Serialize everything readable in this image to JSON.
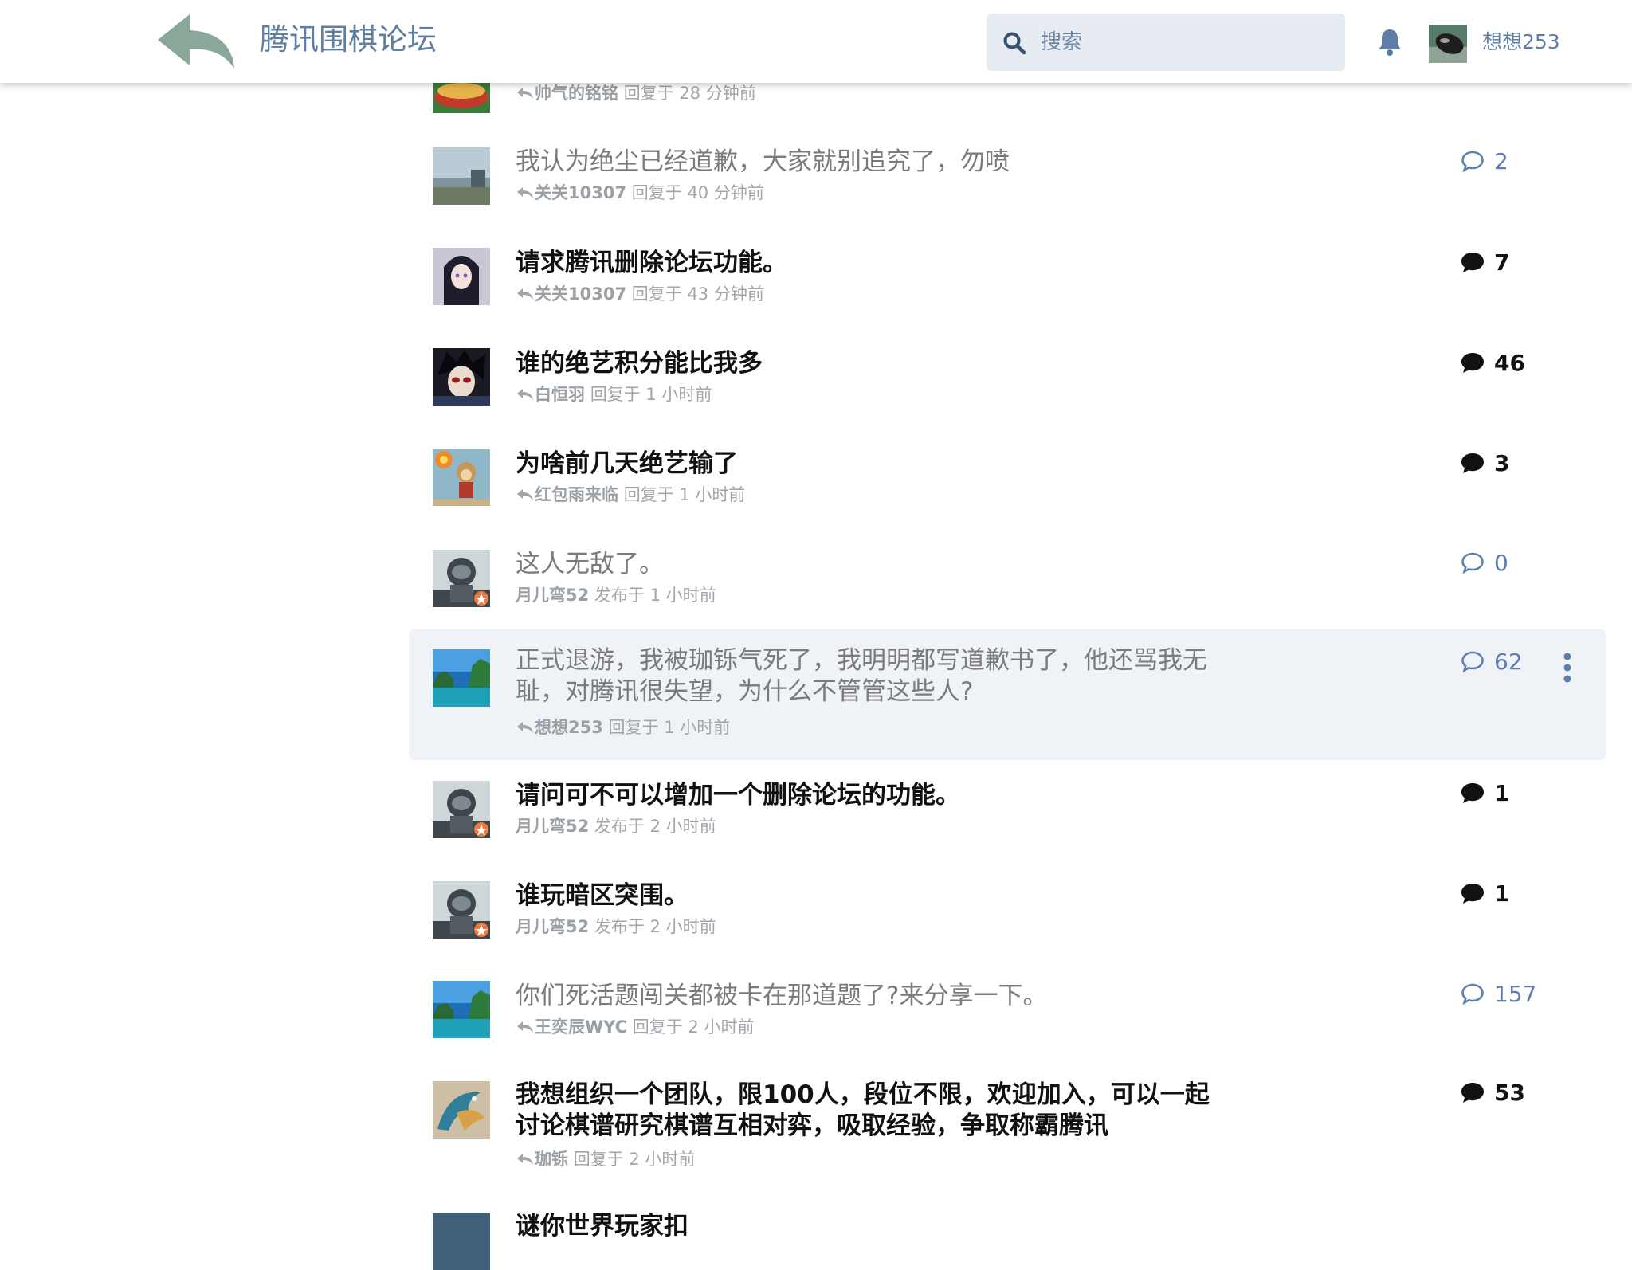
{
  "header": {
    "forum_title": "腾讯围棋论坛",
    "search_placeholder": "搜索",
    "username": "想想253",
    "back_icon": "reply-arrow-icon",
    "notification_icon": "bell-icon"
  },
  "colors": {
    "accent": "#5d7fa6",
    "search_bg": "#e7ecf3",
    "active_row_bg": "#eff3f7",
    "unread_title": "#111111",
    "read_title": "#7b7b7b",
    "meta_text": "#a2a6ab",
    "read_count": "#5f7eb0"
  },
  "topics": [
    {
      "title": "",
      "user": "帅气的铭铭",
      "action": "回复于",
      "time": "28 分钟前",
      "replies": "",
      "read": true,
      "replied": true,
      "avatar": "food"
    },
    {
      "title": "我认为绝尘已经道歉，大家就别追究了，勿喷",
      "user": "关关10307",
      "action": "回复于",
      "time": "40 分钟前",
      "replies": "2",
      "read": true,
      "replied": true,
      "avatar": "landscape"
    },
    {
      "title": "请求腾讯删除论坛功能。",
      "user": "关关10307",
      "action": "回复于",
      "time": "43 分钟前",
      "replies": "7",
      "read": false,
      "replied": true,
      "avatar": "anime-girl"
    },
    {
      "title": "谁的绝艺积分能比我多",
      "user": "白恒羽",
      "action": "回复于",
      "time": "1 小时前",
      "replies": "46",
      "read": false,
      "replied": true,
      "avatar": "anime-boy"
    },
    {
      "title": "为啥前几天绝艺输了",
      "user": "红包雨来临",
      "action": "回复于",
      "time": "1 小时前",
      "replies": "3",
      "read": false,
      "replied": true,
      "avatar": "monkey"
    },
    {
      "title": "这人无敌了。",
      "user": "月儿弯52",
      "action": "发布于",
      "time": "1 小时前",
      "replies": "0",
      "read": true,
      "replied": false,
      "avatar": "astronaut"
    },
    {
      "title": "正式退游，我被珈铄气死了，我明明都写道歉书了，他还骂我无耻，对腾讯很失望，为什么不管管这些人?",
      "user": "想想253",
      "action": "回复于",
      "time": "1 小时前",
      "replies": "62",
      "read": true,
      "replied": true,
      "avatar": "lake",
      "active": true
    },
    {
      "title": "请问可不可以增加一个删除论坛的功能。",
      "user": "月儿弯52",
      "action": "发布于",
      "time": "2 小时前",
      "replies": "1",
      "read": false,
      "replied": false,
      "avatar": "astronaut"
    },
    {
      "title": "谁玩暗区突围。",
      "user": "月儿弯52",
      "action": "发布于",
      "time": "2 小时前",
      "replies": "1",
      "read": false,
      "replied": false,
      "avatar": "astronaut"
    },
    {
      "title": "你们死活题闯关都被卡在那道题了?来分享一下。",
      "user": "王奕辰WYC",
      "action": "回复于",
      "time": "2 小时前",
      "replies": "157",
      "read": true,
      "replied": true,
      "avatar": "lake"
    },
    {
      "title": "我想组织一个团队，限100人，段位不限，欢迎加入，可以一起讨论棋谱研究棋谱互相对弈，吸取经验，争取称霸腾讯",
      "user": "珈铄",
      "action": "回复于",
      "time": "2 小时前",
      "replies": "53",
      "read": false,
      "replied": true,
      "avatar": "dragon"
    },
    {
      "title": "谜你世界玩家扣",
      "user": "",
      "action": "",
      "time": "",
      "replies": "",
      "read": false,
      "replied": false,
      "avatar": "partial"
    }
  ]
}
